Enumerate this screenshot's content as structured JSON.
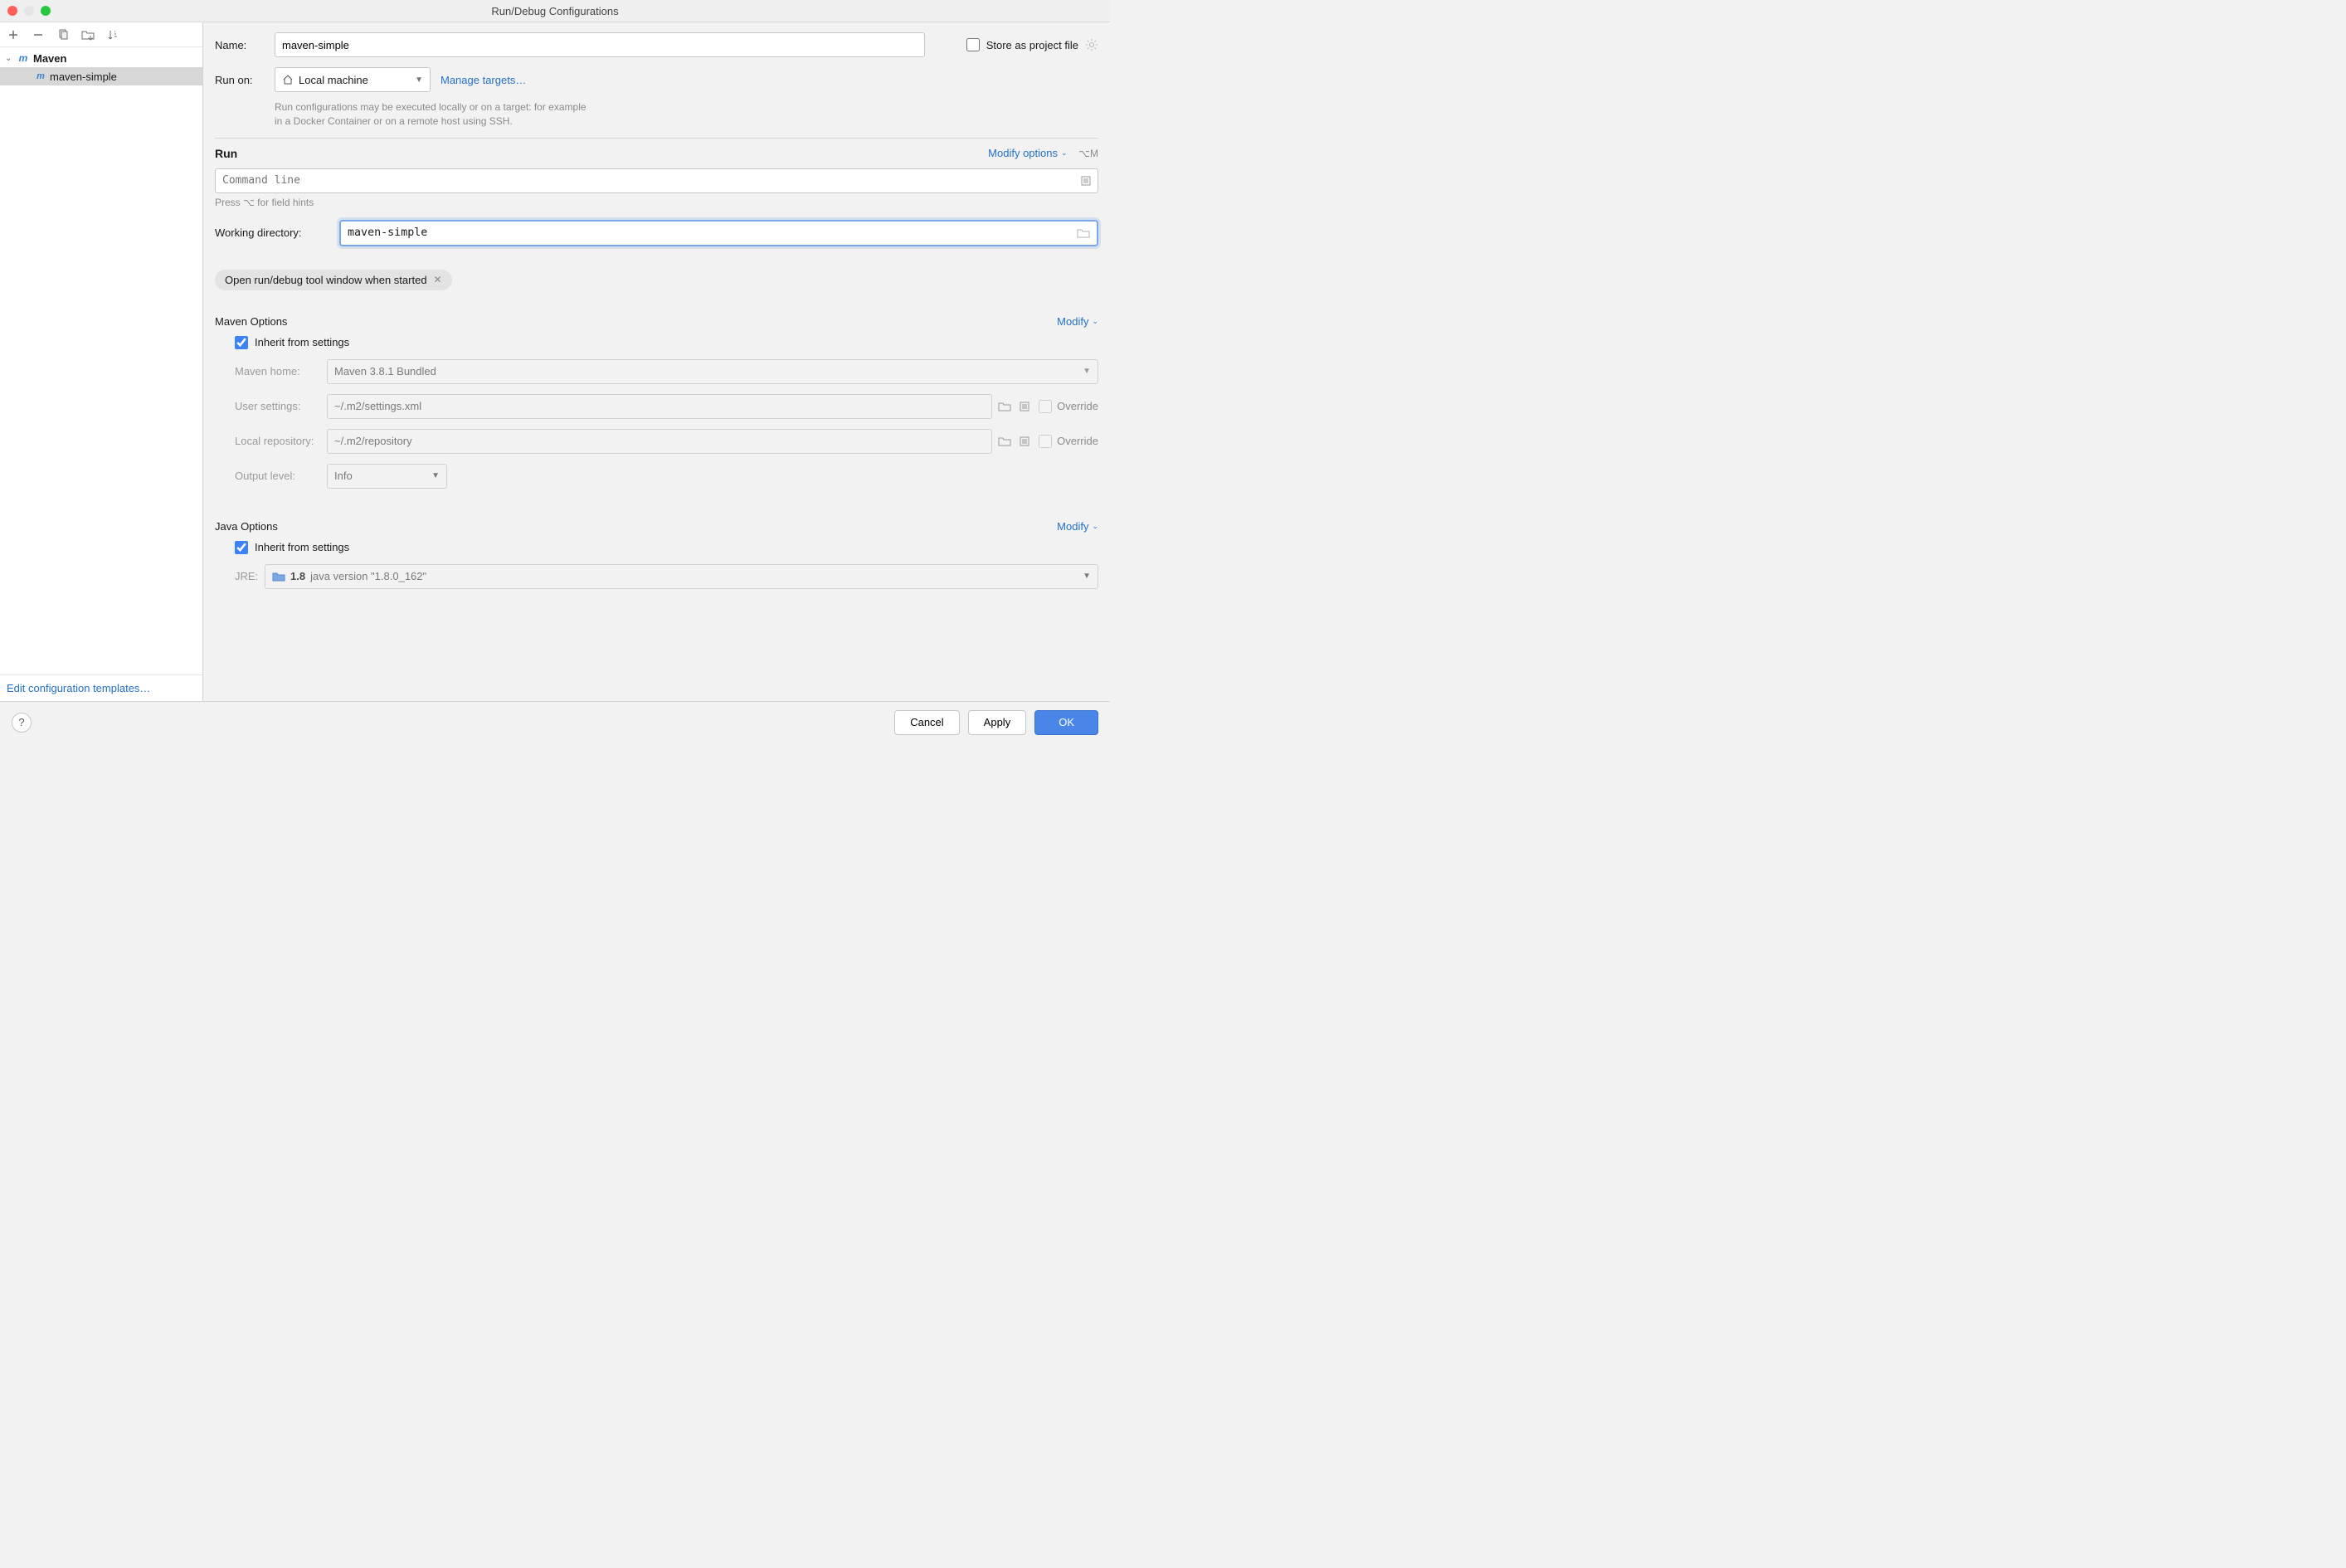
{
  "window": {
    "title": "Run/Debug Configurations"
  },
  "sidebar": {
    "root": {
      "label": "Maven"
    },
    "items": [
      {
        "label": "maven-simple"
      }
    ],
    "footer_link": "Edit configuration templates…"
  },
  "form": {
    "name_label": "Name:",
    "name_value": "maven-simple",
    "store_as_label": "Store as project file",
    "runon_label": "Run on:",
    "runon_value": "Local machine",
    "manage_targets": "Manage targets…",
    "runon_help1": "Run configurations may be executed locally or on a target: for example",
    "runon_help2": "in a Docker Container or on a remote host using SSH."
  },
  "run": {
    "heading": "Run",
    "modify": "Modify options",
    "shortcut": "⌥M",
    "cmd_placeholder": "Command line",
    "hint": "Press ⌥ for field hints",
    "wd_label": "Working directory:",
    "wd_value": "maven-simple",
    "chip": "Open run/debug tool window when started"
  },
  "maven": {
    "heading": "Maven Options",
    "modify": "Modify",
    "inherit": "Inherit from settings",
    "home_label": "Maven home:",
    "home_value": "Maven 3.8.1 Bundled",
    "user_label": "User settings:",
    "user_value": "~/.m2/settings.xml",
    "repo_label": "Local repository:",
    "repo_value": "~/.m2/repository",
    "output_label": "Output level:",
    "output_value": "Info",
    "override": "Override"
  },
  "java": {
    "heading": "Java Options",
    "modify": "Modify",
    "inherit": "Inherit from settings",
    "jre_label": "JRE:",
    "jre_bold": "1.8",
    "jre_rest": "java version \"1.8.0_162\""
  },
  "footer": {
    "cancel": "Cancel",
    "apply": "Apply",
    "ok": "OK"
  }
}
